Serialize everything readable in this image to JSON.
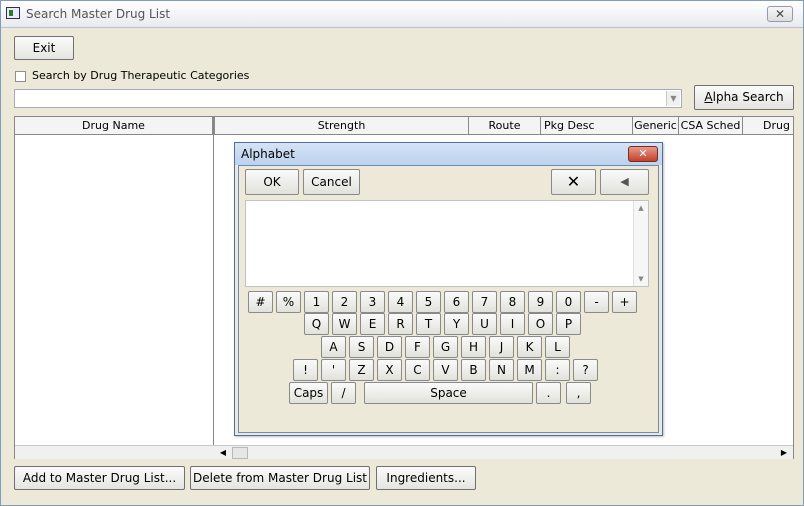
{
  "window": {
    "title": "Search Master Drug List",
    "close_glyph": "✕"
  },
  "toolbar": {
    "exit_label": "Exit"
  },
  "search": {
    "checkbox_label": "Search by Drug Therapeutic Categories",
    "input_value": "",
    "alpha_search_label": "Alpha Search"
  },
  "grid": {
    "columns": [
      "Drug Name",
      "Strength",
      "Route",
      "Pkg Desc",
      "Generic",
      "CSA Sched",
      "Drug I"
    ]
  },
  "footer": {
    "add_label": "Add to Master Drug List...",
    "delete_label": "Delete from Master Drug List",
    "ingredients_label": "Ingredients..."
  },
  "dialog": {
    "title": "Alphabet",
    "close_glyph": "✕",
    "ok_label": "OK",
    "cancel_label": "Cancel",
    "clear_glyph": "✕",
    "backspace_glyph": "◀",
    "text_value": "",
    "rows": [
      [
        "#",
        "%",
        "1",
        "2",
        "3",
        "4",
        "5",
        "6",
        "7",
        "8",
        "9",
        "0",
        "-",
        "+"
      ],
      [
        "Q",
        "W",
        "E",
        "R",
        "T",
        "Y",
        "U",
        "I",
        "O",
        "P"
      ],
      [
        "A",
        "S",
        "D",
        "F",
        "G",
        "H",
        "J",
        "K",
        "L"
      ],
      [
        "!",
        "'",
        "Z",
        "X",
        "C",
        "V",
        "B",
        "N",
        "M",
        ":",
        "?"
      ],
      [
        "Caps",
        "/",
        "Space",
        ".",
        ","
      ]
    ]
  }
}
